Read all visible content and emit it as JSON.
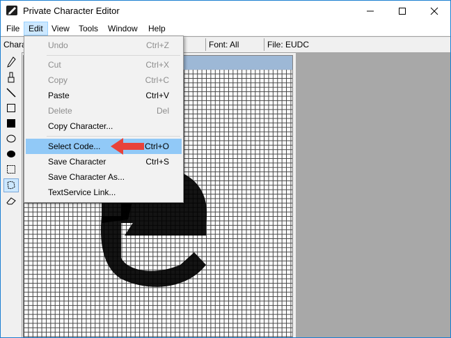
{
  "window": {
    "title": "Private Character Editor",
    "controls": [
      "minimize",
      "maximize",
      "close"
    ]
  },
  "menubar": {
    "items": [
      "File",
      "Edit",
      "View",
      "Tools",
      "Window",
      "Help"
    ],
    "active": "Edit"
  },
  "status": {
    "character_label": "Chara",
    "font": "Font: All",
    "file": "File: EUDC"
  },
  "toolbar": {
    "tools": [
      "pencil-icon",
      "brush-icon",
      "line-icon",
      "hollow-rectangle-icon",
      "filled-rectangle-icon",
      "hollow-ellipse-icon",
      "filled-ellipse-icon",
      "rectangular-selection-icon",
      "freeform-selection-icon",
      "eraser-icon"
    ],
    "selected": "freeform-selection-icon"
  },
  "edit_menu": {
    "items": [
      {
        "label": "Undo",
        "shortcut": "Ctrl+Z",
        "enabled": false
      },
      {
        "label": "Cut",
        "shortcut": "Ctrl+X",
        "enabled": false
      },
      {
        "label": "Copy",
        "shortcut": "Ctrl+C",
        "enabled": false
      },
      {
        "label": "Paste",
        "shortcut": "Ctrl+V",
        "enabled": true
      },
      {
        "label": "Delete",
        "shortcut": "Del",
        "enabled": false
      },
      {
        "label": "Copy Character...",
        "shortcut": "",
        "enabled": true
      },
      {
        "label": "Select Code...",
        "shortcut": "Ctrl+O",
        "enabled": true,
        "highlighted": true
      },
      {
        "label": "Save Character",
        "shortcut": "Ctrl+S",
        "enabled": true
      },
      {
        "label": "Save Character As...",
        "shortcut": "",
        "enabled": true
      },
      {
        "label": "TextService Link...",
        "shortcut": "",
        "enabled": true
      }
    ]
  },
  "colors": {
    "highlight": "#91c9f7",
    "annotation_arrow": "#e8423a",
    "reference_pane": "#a8a8a8"
  }
}
